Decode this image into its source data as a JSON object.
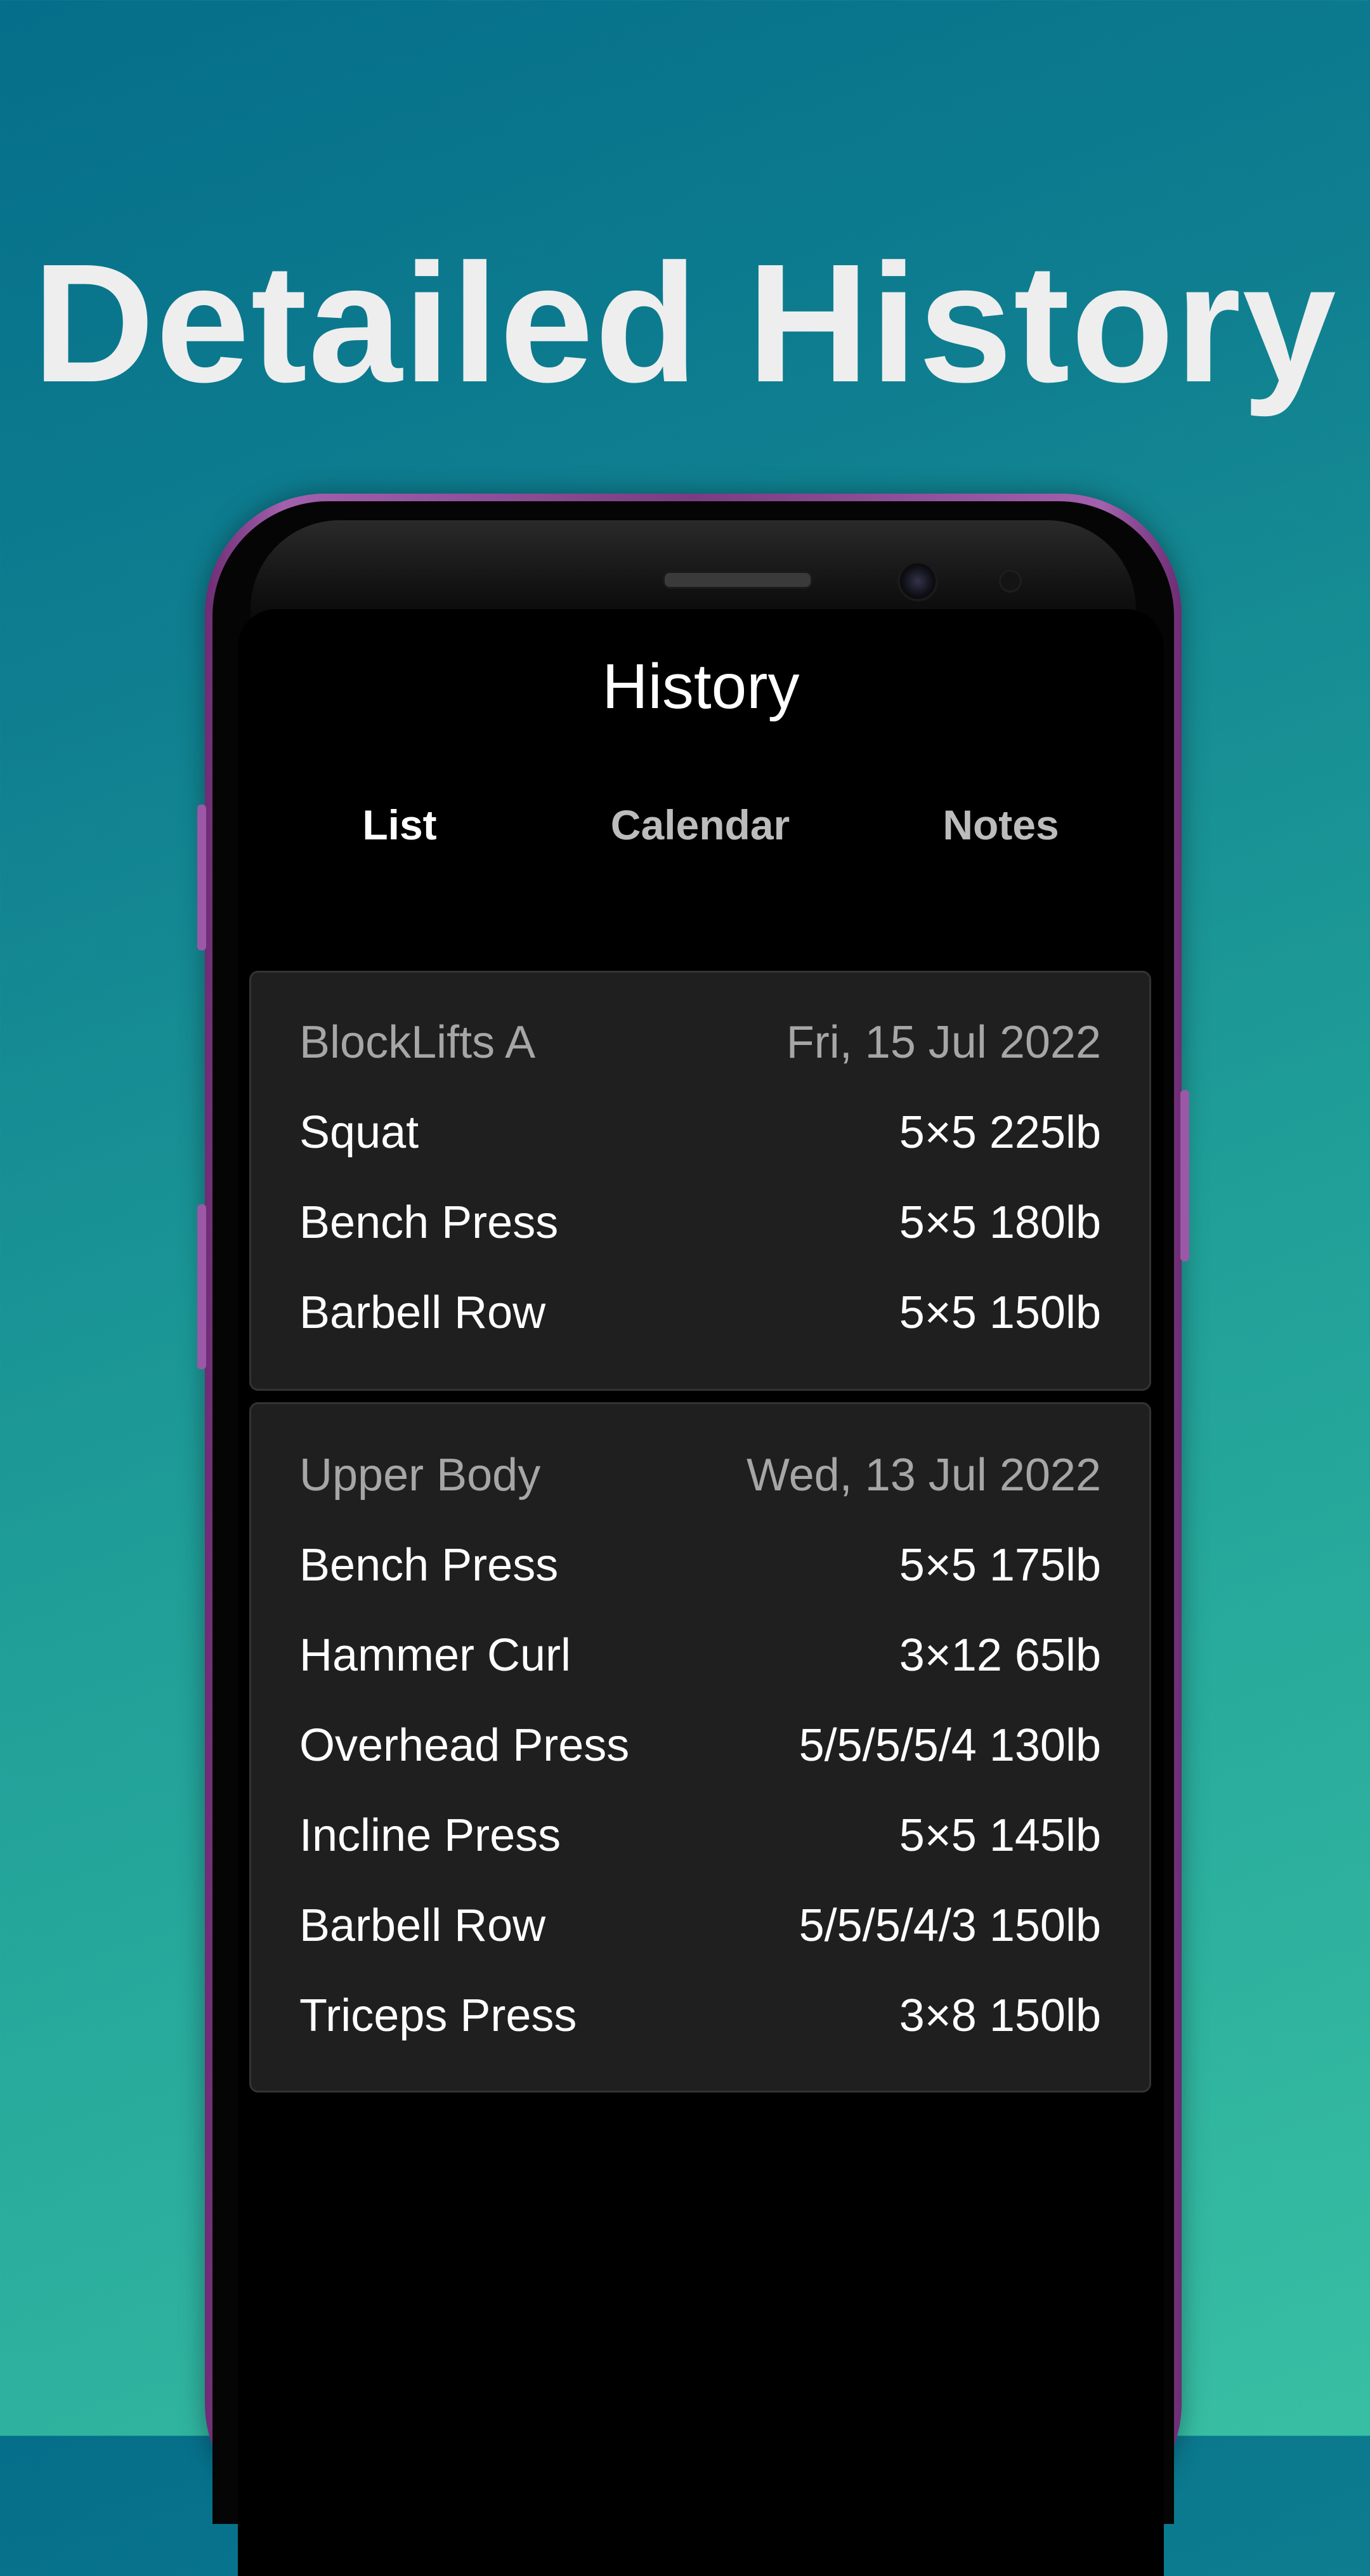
{
  "headline": "Detailed History",
  "app": {
    "title": "History",
    "tabs": [
      {
        "label": "List",
        "active": true
      },
      {
        "label": "Calendar",
        "active": false
      },
      {
        "label": "Notes",
        "active": false
      }
    ],
    "accent_color": "#d32f2f"
  },
  "workouts": [
    {
      "name": "BlockLifts A",
      "date": "Fri, 15 Jul 2022",
      "exercises": [
        {
          "name": "Squat",
          "result": "5×5 225lb"
        },
        {
          "name": "Bench Press",
          "result": "5×5 180lb"
        },
        {
          "name": "Barbell Row",
          "result": "5×5 150lb"
        }
      ]
    },
    {
      "name": "Upper Body",
      "date": "Wed, 13 Jul 2022",
      "exercises": [
        {
          "name": "Bench Press",
          "result": "5×5 175lb"
        },
        {
          "name": "Hammer Curl",
          "result": "3×12 65lb"
        },
        {
          "name": "Overhead Press",
          "result": "5/5/5/5/4 130lb"
        },
        {
          "name": "Incline Press",
          "result": "5×5 145lb"
        },
        {
          "name": "Barbell Row",
          "result": "5/5/5/4/3 150lb"
        },
        {
          "name": "Triceps Press",
          "result": "3×8 150lb"
        }
      ]
    }
  ]
}
